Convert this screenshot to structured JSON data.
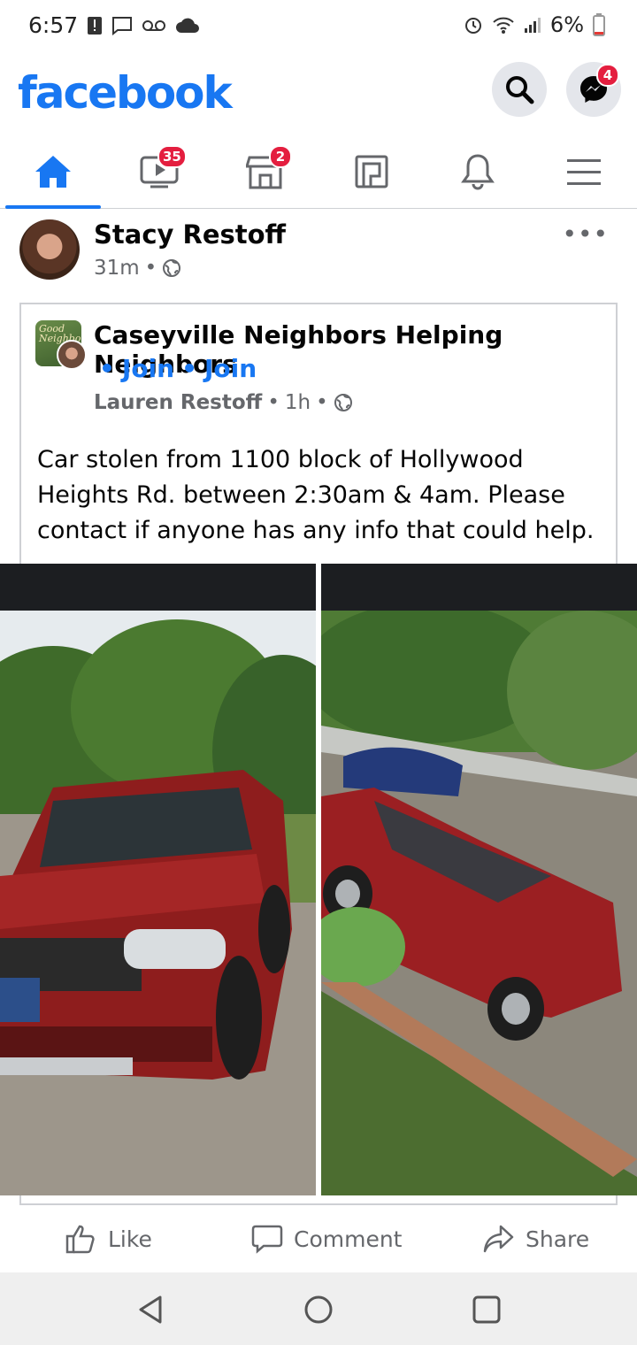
{
  "status_bar": {
    "time": "6:57",
    "battery": "6%"
  },
  "header": {
    "logo": "facebook",
    "messenger_badge": "4"
  },
  "tabs": [
    {
      "name": "home",
      "active": true
    },
    {
      "name": "watch",
      "badge": "35"
    },
    {
      "name": "marketplace",
      "badge": "2"
    },
    {
      "name": "pages"
    },
    {
      "name": "notifications"
    },
    {
      "name": "menu"
    }
  ],
  "post": {
    "author": "Stacy Restoff",
    "time": "31m",
    "shared": {
      "group_name": "Caseyville Neighbors Helping Neighbors",
      "join_1": "Join",
      "join_2": "Join",
      "original_author": "Lauren Restoff",
      "original_time": "1h",
      "text": "Car stolen from 1100 block of Hollywood Heights Rd. between 2:30am & 4am. Please contact if anyone has any info that could help.",
      "group_avatar_text": "Good Neighbors"
    }
  },
  "actions": {
    "like": "Like",
    "comment": "Comment",
    "share": "Share"
  },
  "colors": {
    "brand": "#1877f2",
    "badge": "#e41e3f",
    "secondary_text": "#65676b"
  }
}
